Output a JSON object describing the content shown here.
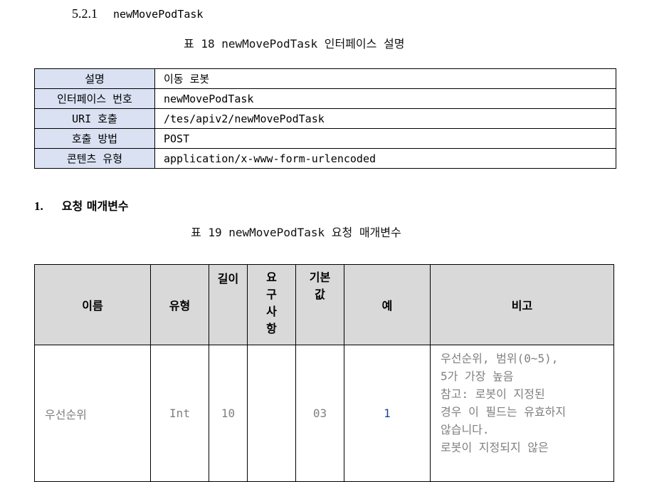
{
  "section": {
    "number": "5.2.1",
    "name": "newMovePodTask"
  },
  "caption1": "표 18 newMovePodTask 인터페이스 설명",
  "interface": [
    {
      "key": "설명",
      "value": "이동 로봇"
    },
    {
      "key": "인터페이스 번호",
      "value": "newMovePodTask"
    },
    {
      "key": "URI 호출",
      "value": "/tes/apiv2/newMovePodTask"
    },
    {
      "key": "호출 방법",
      "value": "POST"
    },
    {
      "key": "콘텐츠 유형",
      "value": "application/x-www-form-urlencoded"
    }
  ],
  "heading1": {
    "number": "1.",
    "title": "요청 매개변수"
  },
  "caption2": "표 19 newMovePodTask 요청 매개변수",
  "params_header": {
    "name": "이름",
    "type": "유형",
    "length": "길이",
    "required": [
      "요",
      "구",
      "사",
      "항"
    ],
    "default": [
      "기본",
      "값"
    ],
    "example": "예",
    "note": "비고"
  },
  "params_rows": [
    {
      "name": "우선순위",
      "type": "Int",
      "length": "10",
      "required": "",
      "default": "03",
      "example": "1",
      "note": [
        "우선순위, 범위(0~5),",
        "5가 가장 높음",
        "참고: 로봇이 지정된",
        "경우 이 필드는 유효하지",
        "않습니다.",
        "로봇이 지정되지 않은"
      ]
    }
  ]
}
